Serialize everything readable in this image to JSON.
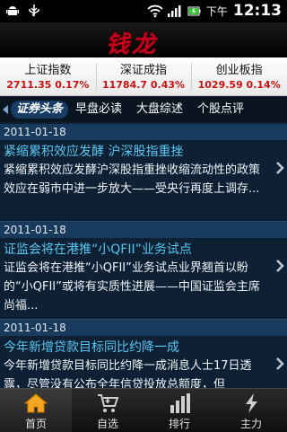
{
  "statusbar": {
    "ampm": "下午",
    "time": "12:13"
  },
  "app": {
    "logo_text": "钱龙"
  },
  "indices": [
    {
      "name": "上证指数",
      "value": "2711.35 0.17%"
    },
    {
      "name": "深证成指",
      "value": "11784.7 0.43%"
    },
    {
      "name": "创业板指",
      "value": "1029.59 0.14%"
    }
  ],
  "tabs": [
    {
      "label": "证券头条"
    },
    {
      "label": "早盘必读"
    },
    {
      "label": "大盘综述"
    },
    {
      "label": "个股点评"
    }
  ],
  "news": [
    {
      "date": "2011-01-18",
      "title": "紧缩累积效应发酵 沪深股指重挫",
      "summary": "紧缩累积效应发酵沪深股指重挫收缩流动性的政策效应在弱市中进一步放大——受央行再度上调存..."
    },
    {
      "date": "2011-01-18",
      "title": "证监会将在港推“小QFII”业务试点",
      "summary": "证监会将在港推“小QFII”业务试点业界翘首以盼的“小QFII”或将有实质性进展——中国证监会主席尚福..."
    },
    {
      "date": "2011-01-18",
      "title": "今年新增贷款目标同比约降一成",
      "summary": "今年新增贷款目标同比约降一成消息人士17日透露，尽管没有公布全年信贷投放总额度，但"
    }
  ],
  "bottomnav": [
    {
      "label": "首页"
    },
    {
      "label": "自选"
    },
    {
      "label": "排行"
    },
    {
      "label": "主力"
    }
  ],
  "colors": {
    "index_value": "#cc1111",
    "news_title": "#59c6f0",
    "date_bar": "#183a5d",
    "background": "#0e2134"
  }
}
